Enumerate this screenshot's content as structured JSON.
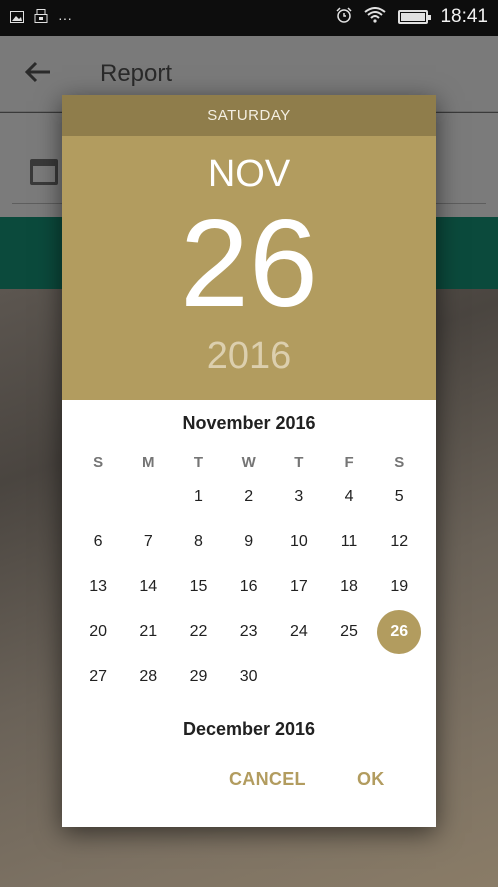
{
  "status_bar": {
    "time": "18:41",
    "left_icons": [
      "image-icon",
      "usb-icon",
      "more-icon"
    ],
    "right_icons": [
      "alarm-icon",
      "wifi-icon",
      "battery-icon"
    ]
  },
  "app": {
    "title": "Report",
    "back_icon": "arrow-back-icon",
    "field_icon": "calendar-icon"
  },
  "dialog": {
    "header": {
      "day_of_week": "SATURDAY",
      "month": "NOV",
      "day": "26",
      "year": "2016"
    },
    "month_title": "November 2016",
    "next_month_title": "December 2016",
    "weekdays": [
      "S",
      "M",
      "T",
      "W",
      "T",
      "F",
      "S"
    ],
    "weeks": [
      [
        "",
        "",
        "1",
        "2",
        "3",
        "4",
        "5"
      ],
      [
        "6",
        "7",
        "8",
        "9",
        "10",
        "11",
        "12"
      ],
      [
        "13",
        "14",
        "15",
        "16",
        "17",
        "18",
        "19"
      ],
      [
        "20",
        "21",
        "22",
        "23",
        "24",
        "25",
        "26"
      ],
      [
        "27",
        "28",
        "29",
        "30",
        "",
        "",
        ""
      ]
    ],
    "selected_day": "26",
    "cancel_label": "CANCEL",
    "ok_label": "OK"
  },
  "colors": {
    "accent": "#b29c5f",
    "header_dark": "#8f7d4b",
    "year_text": "#dccfae"
  }
}
